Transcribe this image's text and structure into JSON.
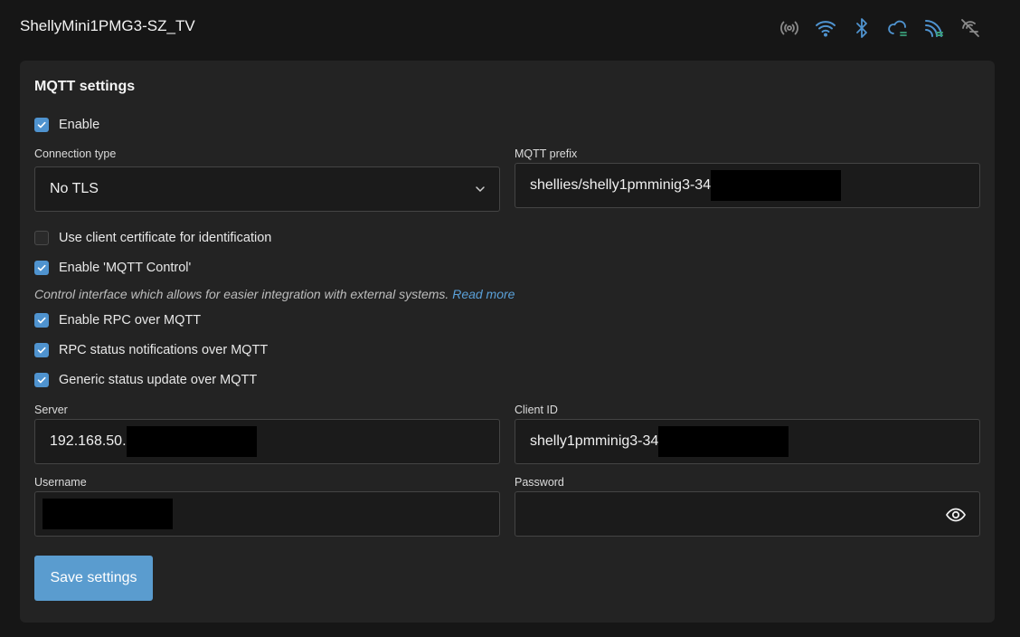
{
  "header": {
    "device_name": "ShellyMini1PMG3-SZ_TV",
    "status_icons": [
      "broadcast-icon",
      "wifi-icon",
      "bluetooth-icon",
      "cloud-icon",
      "mqtt-icon",
      "connection-off-icon"
    ],
    "icon_color": "#4f93cf"
  },
  "form": {
    "title": "MQTT settings",
    "enable_label": "Enable",
    "enable_checked": true,
    "connection_type_label": "Connection type",
    "connection_type_value": "No TLS",
    "mqtt_prefix_label": "MQTT prefix",
    "mqtt_prefix_value": "shellies/shelly1pmminig3-34",
    "client_cert_label": "Use client certificate for identification",
    "client_cert_checked": false,
    "mqtt_control_label": "Enable 'MQTT Control'",
    "mqtt_control_checked": true,
    "hint_text": "Control interface which allows for easier integration with external systems.",
    "hint_link": "Read more",
    "rpc_label": "Enable RPC over MQTT",
    "rpc_checked": true,
    "rpc_status_label": "RPC status notifications over MQTT",
    "rpc_status_checked": true,
    "generic_status_label": "Generic status update over MQTT",
    "generic_status_checked": true,
    "server_label": "Server",
    "server_value": "192.168.50.",
    "client_id_label": "Client ID",
    "client_id_value": "shelly1pmminig3-34",
    "username_label": "Username",
    "username_value": "",
    "password_label": "Password",
    "password_value": "",
    "save_label": "Save settings"
  },
  "colors": {
    "accent": "#4f93cf",
    "button": "#5a9ccf",
    "link": "#5aa0d8"
  }
}
